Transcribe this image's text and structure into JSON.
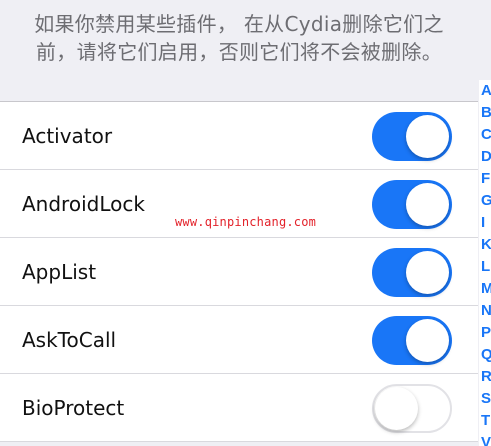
{
  "header": {
    "line1": "如果你禁用某些插件， 在从Cydia删除它们之",
    "line2": "前，请将它们启用，否则它们将不会被删除。"
  },
  "list": {
    "items": [
      {
        "label": "Activator",
        "enabled": true
      },
      {
        "label": "AndroidLock",
        "enabled": true
      },
      {
        "label": "AppList",
        "enabled": true
      },
      {
        "label": "AskToCall",
        "enabled": true
      },
      {
        "label": "BioProtect",
        "enabled": false
      }
    ]
  },
  "watermark": "www.qinpinchang.com",
  "index": [
    "A",
    "B",
    "C",
    "D",
    "F",
    "G",
    "I",
    "K",
    "L",
    "M",
    "N",
    "P",
    "Q",
    "R",
    "S",
    "T",
    "V"
  ],
  "colors": {
    "accent": "#1976f7",
    "background": "#efeff4",
    "row_separator": "#d9d9de",
    "watermark": "#e3222a"
  }
}
